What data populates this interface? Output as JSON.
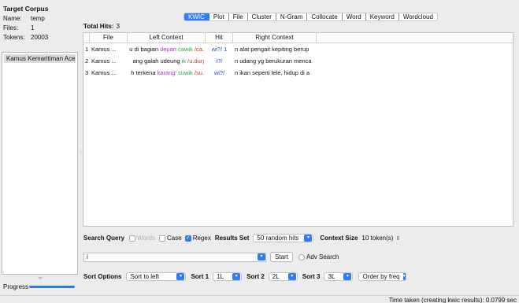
{
  "corpus": {
    "title": "Target Corpus",
    "name_label": "Name:",
    "name_value": "temp",
    "files_label": "Files:",
    "files_value": "1",
    "tokens_label": "Tokens:",
    "tokens_value": "20003",
    "file_items": [
      "Kamus Kemaritiman Aceh"
    ]
  },
  "progress": {
    "label": "Progress",
    "value": 1.0
  },
  "tabs": [
    "KWIC",
    "Plot",
    "File",
    "Cluster",
    "N-Gram",
    "Collocate",
    "Word",
    "Keyword",
    "Wordcloud"
  ],
  "active_tab": "KWIC",
  "total_hits": {
    "label": "Total Hits:",
    "value": "3"
  },
  "table": {
    "headers": [
      "File",
      "Left Context",
      "Hit",
      "Right Context"
    ],
    "rows": [
      {
        "idx": "1",
        "file": "Kamus ...",
        "left": [
          {
            "t": "u di bagian ",
            "c": ""
          },
          {
            "t": "depan",
            "c": "purple"
          },
          {
            "t": " ",
            "c": ""
          },
          {
            "t": "cawik",
            "c": "green"
          },
          {
            "t": " /ca.",
            "c": "red"
          }
        ],
        "hit": "wi?/ 1",
        "right": "n alat pengait kepiting berup"
      },
      {
        "idx": "2",
        "file": "Kamus ...",
        "left": [
          {
            "t": "ang galah udeung ",
            "c": ""
          },
          {
            "t": "ik",
            "c": "green"
          },
          {
            "t": " /u.duŋ",
            "c": "red"
          }
        ],
        "hit": "i?/",
        "right": "n udang yg berukuran menca"
      },
      {
        "idx": "3",
        "file": "Kamus ...",
        "left": [
          {
            "t": "h terkena ",
            "c": ""
          },
          {
            "t": "karang'",
            "c": "purple"
          },
          {
            "t": " ",
            "c": ""
          },
          {
            "t": "suwik",
            "c": "green"
          },
          {
            "t": " /su.",
            "c": "red"
          }
        ],
        "hit": "wi?/",
        "right": "n ikan seperti lele, hidup di a"
      }
    ]
  },
  "search": {
    "label": "Search Query",
    "words_label": "Words",
    "case_label": "Case",
    "regex_label": "Regex",
    "words_checked": false,
    "case_checked": false,
    "regex_checked": true,
    "results_set_label": "Results Set",
    "results_set_value": "50 random hits",
    "context_size_label": "Context Size",
    "context_size_value": "10 token(s)",
    "query_value": "i",
    "start_label": "Start",
    "adv_label": "Adv Search"
  },
  "sort": {
    "label": "Sort Options",
    "mode": "Sort to left",
    "sort1_label": "Sort 1",
    "sort1_value": "1L",
    "sort2_label": "Sort 2",
    "sort2_value": "2L",
    "sort3_label": "Sort 3",
    "sort3_value": "3L",
    "order_value": "Order by freq"
  },
  "status": {
    "text": "Time taken (creating kwic results): 0.0799 sec"
  },
  "colors": {
    "accent": "#2f7cf6",
    "kw_purple": "#b431d8",
    "kw_green": "#2fa82f",
    "kw_red": "#e0322b",
    "hit_blue": "#1f4fe0"
  }
}
